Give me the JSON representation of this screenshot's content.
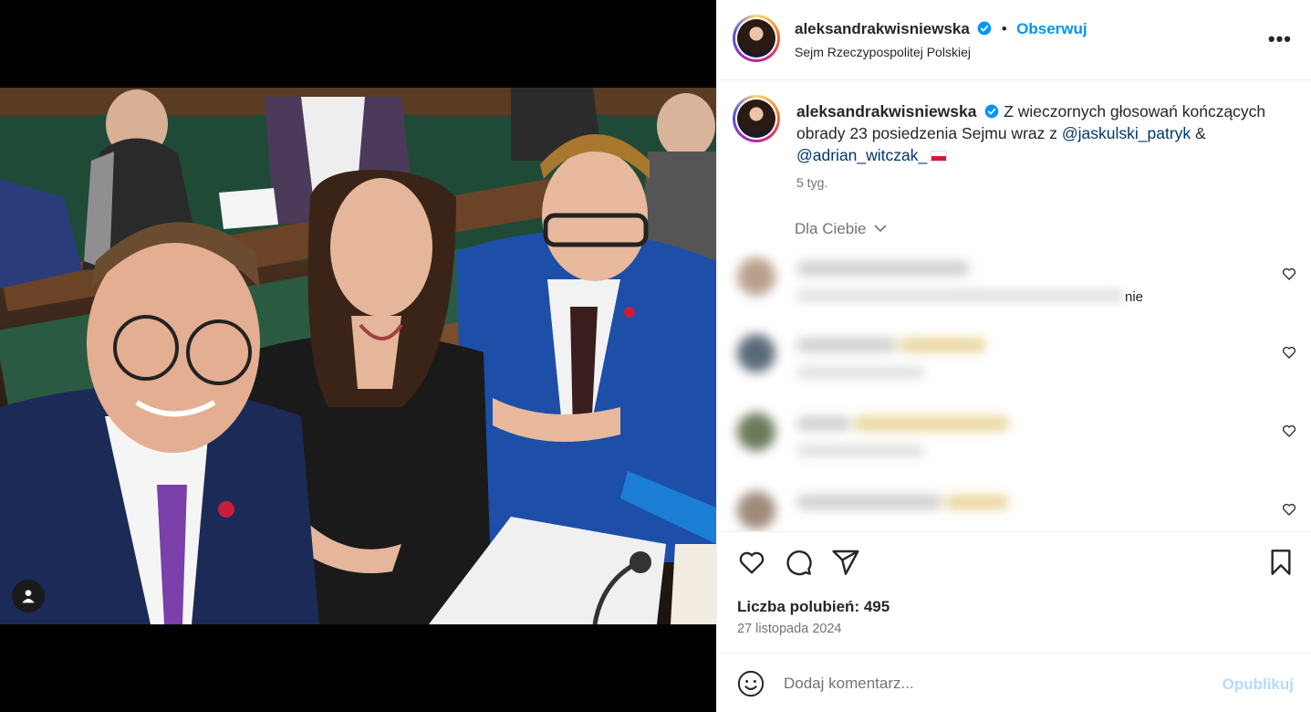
{
  "post": {
    "username": "aleksandrakwisniewska",
    "follow_label": "Obserwuj",
    "separator": "•",
    "location": "Sejm Rzeczypospolitej Polskiej",
    "more_label": "•••"
  },
  "caption": {
    "username": "aleksandrakwisniewska",
    "text_part1": "Z wieczornych głosowań kończących obrady 23 posiedzenia Sejmu wraz z",
    "mention1": "@jaskulski_patryk",
    "ampersand": "&",
    "mention2": "@adrian_witczak_",
    "age": "5 tyg."
  },
  "comments": {
    "filter_label": "Dla Ciebie",
    "visible_tail": "nie",
    "count_blurred": 4
  },
  "actions": {
    "likes_label": "Liczba polubień: 495",
    "date": "27 listopada 2024"
  },
  "compose": {
    "placeholder": "Dodaj komentarz...",
    "publish_label": "Opublikuj"
  },
  "icons": [
    "user-tag-icon",
    "verified-icon",
    "more-icon",
    "chevron-down-icon",
    "heart-icon",
    "comment-icon",
    "share-icon",
    "bookmark-icon",
    "emoji-icon"
  ],
  "colors": {
    "link": "#0095f6",
    "mention": "#00376b",
    "muted": "#737373",
    "publish_disabled": "#b3dbff"
  }
}
